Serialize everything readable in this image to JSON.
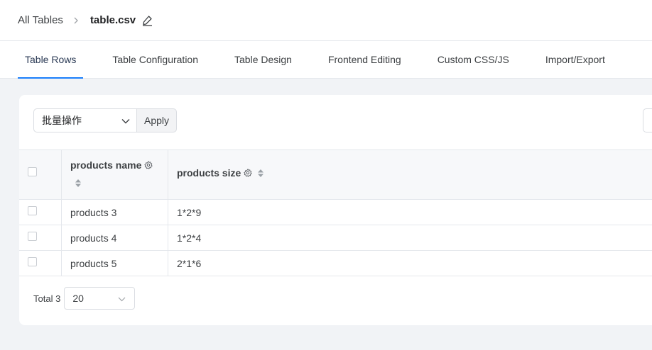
{
  "breadcrumb": {
    "parent": "All Tables",
    "current": "table.csv"
  },
  "icons": {
    "breadcrumb_sep": "chevron-right-icon",
    "edit": "pencil-icon",
    "dropdown": "chevron-down-icon",
    "column_settings": "gear-icon",
    "sort": "sort-icon"
  },
  "tabs": [
    {
      "label": "Table Rows",
      "active": true
    },
    {
      "label": "Table Configuration",
      "active": false
    },
    {
      "label": "Table Design",
      "active": false
    },
    {
      "label": "Frontend Editing",
      "active": false
    },
    {
      "label": "Custom CSS/JS",
      "active": false
    },
    {
      "label": "Import/Export",
      "active": false
    }
  ],
  "toolbar": {
    "bulk_action": "批量操作",
    "apply_label": "Apply"
  },
  "table": {
    "columns": [
      "products name",
      "products size"
    ],
    "rows": [
      [
        "products 3",
        "1*2*9"
      ],
      [
        "products 4",
        "1*2*4"
      ],
      [
        "products 5",
        "2*1*6"
      ]
    ]
  },
  "pagination": {
    "total": "Total 3",
    "page_size": "20"
  },
  "colors": {
    "accent": "#1a7efb",
    "background": "#f1f3f6"
  }
}
